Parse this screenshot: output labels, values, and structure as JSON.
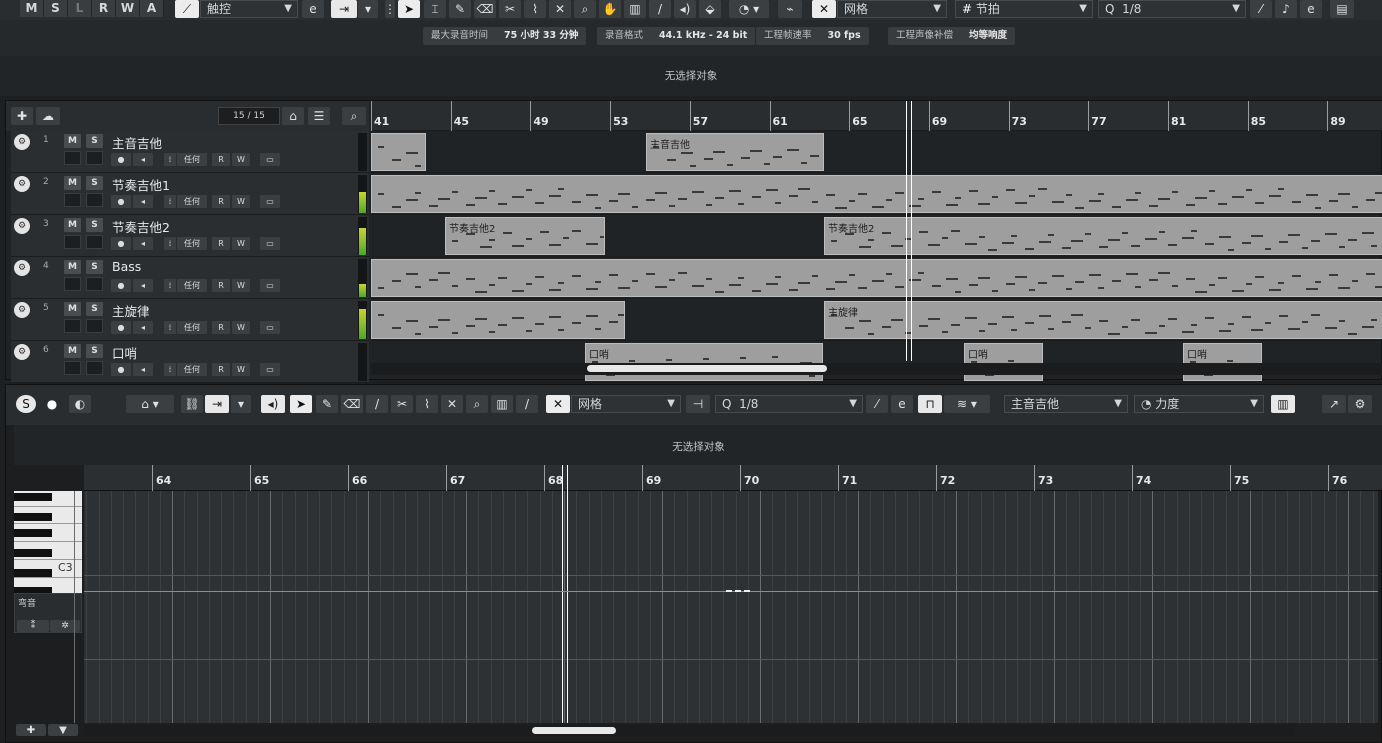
{
  "topbar": {
    "mode_buttons": [
      "M",
      "S",
      "L",
      "R",
      "W",
      "A"
    ],
    "automation_mode": "触控",
    "snap_type": "网格",
    "grid_type": "节拍",
    "quantize_label": "Q",
    "quantize_value": "1/8"
  },
  "infobar": {
    "items": [
      {
        "label": "最大录音时间",
        "value": "75 小时 33 分钟"
      },
      {
        "label": "录音格式",
        "value": "44.1 kHz - 24 bit"
      },
      {
        "label": "工程帧速率",
        "value": "30 fps"
      },
      {
        "label": "工程声像补偿",
        "value": "均等响度"
      }
    ]
  },
  "project": {
    "no_selection": "无选择对象",
    "track_count": "15 / 15",
    "ruler": [
      "41",
      "45",
      "49",
      "53",
      "57",
      "61",
      "65",
      "69",
      "73",
      "77",
      "81",
      "85",
      "89"
    ],
    "tracks": [
      {
        "num": "1",
        "name": "主音吉他",
        "parts": [
          {
            "label": ""
          },
          {
            "label": "主音吉他"
          }
        ]
      },
      {
        "num": "2",
        "name": "节奏吉他1",
        "parts": [
          {
            "label": ""
          }
        ]
      },
      {
        "num": "3",
        "name": "节奏吉他2",
        "parts": [
          {
            "label": "节奏吉他2"
          },
          {
            "label": "节奏吉他2"
          }
        ]
      },
      {
        "num": "4",
        "name": "Bass",
        "parts": [
          {
            "label": ""
          }
        ]
      },
      {
        "num": "5",
        "name": "主旋律",
        "parts": [
          {
            "label": ""
          },
          {
            "label": "主旋律"
          }
        ]
      },
      {
        "num": "6",
        "name": "口哨",
        "parts": [
          {
            "label": "口哨"
          },
          {
            "label": "口哨"
          },
          {
            "label": "口哨"
          }
        ]
      }
    ],
    "track_buttons": {
      "mute": "M",
      "solo": "S",
      "read": "R",
      "write": "W",
      "any": "任何"
    }
  },
  "editor": {
    "snap_type": "网格",
    "quantize_label": "Q",
    "quantize_value": "1/8",
    "track_select": "主音吉他",
    "controller": "力度",
    "no_selection": "无选择对象",
    "ruler": [
      "64",
      "65",
      "66",
      "67",
      "68",
      "69",
      "70",
      "71",
      "72",
      "73",
      "74",
      "75",
      "76"
    ],
    "key_label": "C3",
    "controller_lane": "弯音"
  }
}
